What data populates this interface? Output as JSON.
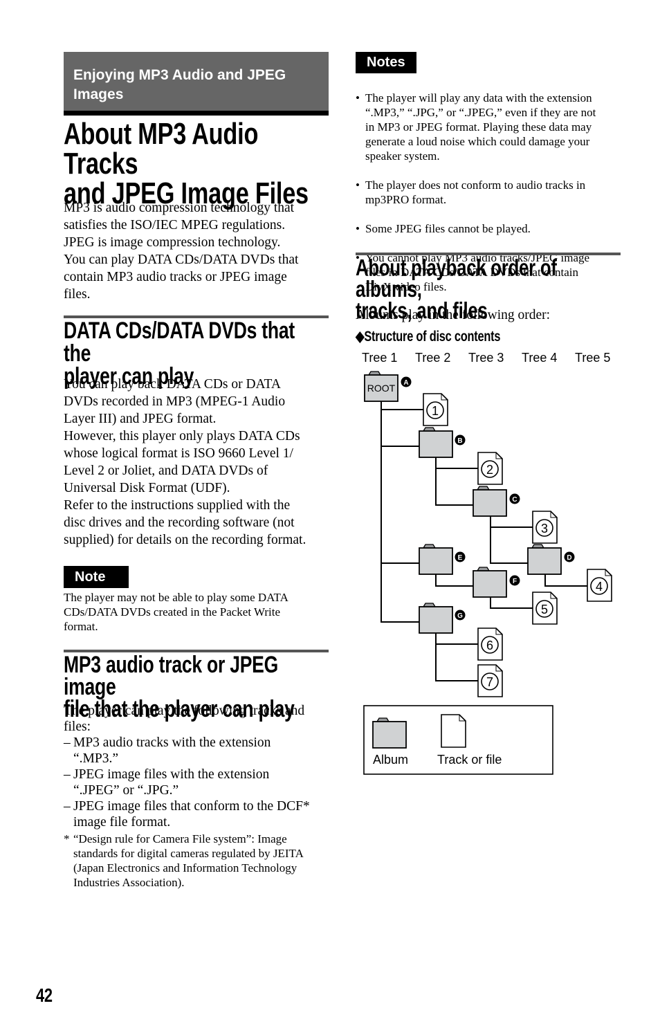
{
  "section_header": "Enjoying MP3 Audio and JPEG\nImages",
  "page_title": "About MP3 Audio Tracks\nand JPEG Image Files",
  "intro": "MP3 is audio compression technology that\nsatisfies the ISO/IEC MPEG regulations.\nJPEG is image compression technology.\nYou can play DATA CDs/DATA DVDs that\ncontain MP3 audio tracks or JPEG image\nfiles.",
  "section1": {
    "heading": "DATA CDs/DATA DVDs that the\nplayer can play",
    "body": "You can play back DATA CDs or DATA\nDVDs recorded in MP3 (MPEG-1 Audio\nLayer III) and JPEG format.\nHowever, this player only plays DATA CDs\nwhose logical format is ISO 9660 Level 1/\nLevel 2 or Joliet, and DATA DVDs of\nUniversal Disk Format (UDF).\nRefer to the instructions supplied with the\ndisc drives and the recording software (not\nsupplied) for details on the recording format."
  },
  "note": {
    "label": "Note",
    "text": "The player may not be able to play some DATA\nCDs/DATA DVDs created in the Packet Write\nformat."
  },
  "section2": {
    "heading": "MP3 audio track or JPEG image\nfile that the player can play",
    "intro": "The player can play the following tracks and\nfiles:",
    "items": [
      "MP3 audio tracks with the extension\n“.MP3.”",
      "JPEG image files with the extension\n“.JPEG” or “.JPG.”",
      "JPEG image files that conform to the DCF*\nimage file format."
    ],
    "dash": "–",
    "footnote_mark": "*",
    "footnote": "“Design rule for Camera File system”: Image\nstandards for digital cameras regulated by JEITA\n(Japan Electronics and Information Technology\nIndustries Association)."
  },
  "notes": {
    "label": "Notes",
    "items": [
      "The player will play any data with the extension\n“.MP3,” “.JPG,” or “.JPEG,” even if they are not\nin MP3 or JPEG format. Playing these data may\ngenerate a loud noise which could damage your\nspeaker system.",
      "The player does not conform to audio tracks in\nmp3PRO format.",
      "Some JPEG files cannot be played.",
      "You cannot play MP3 audio tracks/JPEG image\nfiles in DATA CDs/DATA DVDs that contain\nDivX video files."
    ]
  },
  "section3": {
    "heading": "About playback order of albums,\ntracks, and files",
    "body": "Albums play in the following order:",
    "subheading": "◆Structure of disc contents"
  },
  "diagram": {
    "trees": [
      "Tree 1",
      "Tree 2",
      "Tree 3",
      "Tree 4",
      "Tree 5"
    ],
    "root_label": "ROOT",
    "folders": [
      "A",
      "B",
      "C",
      "D",
      "E",
      "F",
      "G"
    ],
    "files": [
      "1",
      "2",
      "3",
      "4",
      "5",
      "6",
      "7"
    ],
    "legend": {
      "album": "Album",
      "track": "Track or file"
    },
    "folder_fill": "#d0d2d3"
  },
  "page_number": "42"
}
